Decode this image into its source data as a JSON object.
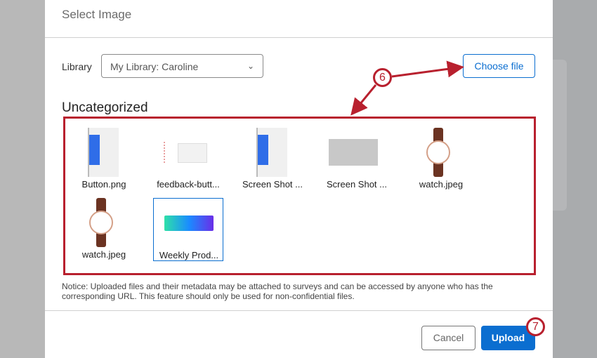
{
  "dialog": {
    "title": "Select Image",
    "library_label": "Library",
    "library_value": "My Library: Caroline",
    "choose_file": "Choose file",
    "section": "Uncategorized",
    "files": [
      {
        "name": "Button.png",
        "kind": "button"
      },
      {
        "name": "feedback-butt...",
        "kind": "screenshot"
      },
      {
        "name": "Screen Shot ...",
        "kind": "button"
      },
      {
        "name": "Screen Shot ...",
        "kind": "gray"
      },
      {
        "name": "watch.jpeg",
        "kind": "watch"
      },
      {
        "name": "watch.jpeg",
        "kind": "watch"
      },
      {
        "name": "Weekly Prod...",
        "kind": "banner",
        "selected": true
      }
    ],
    "notice": "Notice: Uploaded files and their metadata may be attached to surveys and can be accessed by anyone who has the corresponding URL. This feature should only be used for non-confidential files.",
    "cancel": "Cancel",
    "upload": "Upload"
  },
  "annotations": {
    "step6": "6",
    "step7": "7"
  },
  "colors": {
    "accent": "#0b6ed0",
    "annotation": "#b8202e"
  }
}
